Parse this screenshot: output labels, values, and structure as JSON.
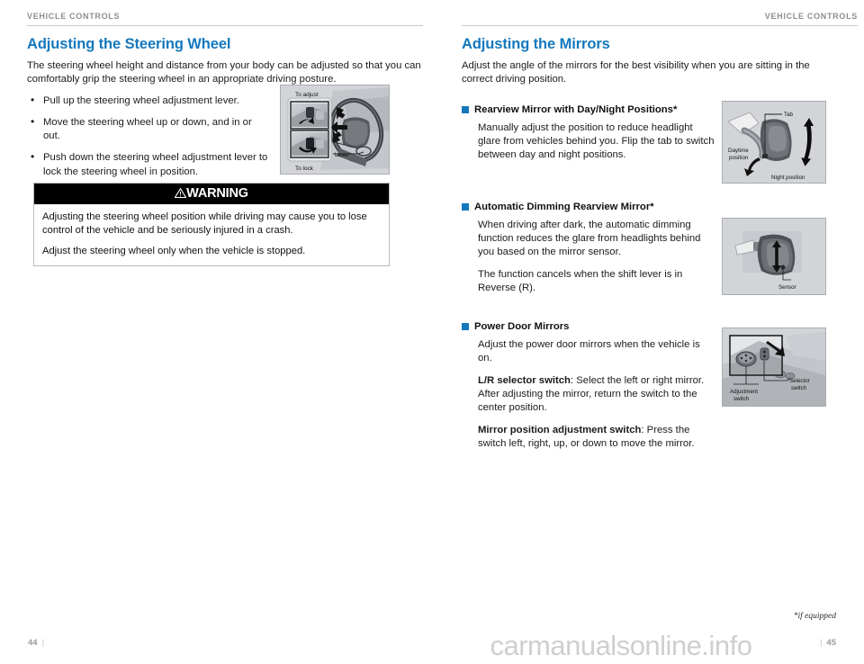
{
  "document": {
    "running_head_left": "VEHICLE CONTROLS",
    "running_head_right": "VEHICLE CONTROLS",
    "footnote": "*if equipped",
    "watermark": "carmanualsonline.info",
    "page_number_left": "44",
    "page_number_right": "45",
    "accent_color": "#1478bd",
    "rule_color": "#c9c9c9"
  },
  "left_column": {
    "title": "Adjusting the Steering Wheel",
    "intro": "The steering wheel height and distance from your body can be adjusted so that you can comfortably grip the steering wheel in an appropriate driving posture.",
    "bullets": [
      "Pull up the steering wheel adjustment lever.",
      "Move the steering wheel up or down, and in or out.",
      "Push down the steering wheel adjustment lever to lock the steering wheel in position."
    ],
    "warning": {
      "title": "WARNING",
      "icon": "warning-triangle-icon",
      "paragraphs": [
        "Adjusting the steering wheel position while driving may cause you to lose control of the vehicle and be seriously injured in a crash.",
        "Adjust the steering wheel only when the vehicle is stopped."
      ]
    },
    "figure": {
      "name": "steering-wheel-adjustment-illustration",
      "labels": {
        "to_adjust": "To adjust",
        "to_lock": "To lock",
        "lever": "Lever"
      }
    }
  },
  "right_column": {
    "title": "Adjusting the Mirrors",
    "intro": "Adjust the angle of the mirrors for the best visibility when you are sitting in the correct driving position.",
    "subsections": [
      {
        "heading": "Rearview Mirror with Day/Night Positions*",
        "paragraphs": [
          {
            "lead": "",
            "text": "Manually adjust the position to reduce headlight glare from vehicles behind you. Flip the tab to switch between day and night positions."
          }
        ],
        "figure": {
          "name": "rearview-mirror-day-night-illustration",
          "labels": {
            "tab": "Tab",
            "daytime_position": "Daytime position",
            "night_position": "Night position"
          }
        }
      },
      {
        "heading": "Automatic Dimming Rearview Mirror*",
        "paragraphs": [
          {
            "lead": "",
            "text": "When driving after dark, the automatic dimming function reduces the glare from headlights behind you based on the mirror sensor."
          },
          {
            "lead": "",
            "text": "The function cancels when the shift lever is in Reverse (R)."
          }
        ],
        "figure": {
          "name": "auto-dimming-mirror-illustration",
          "labels": {
            "sensor": "Sensor"
          }
        }
      },
      {
        "heading": "Power Door Mirrors",
        "paragraphs": [
          {
            "lead": "",
            "text": "Adjust the power door mirrors when the vehicle is on."
          },
          {
            "lead": "L/R selector switch",
            "text": ": Select the left or right mirror. After adjusting the mirror, return the switch to the center position."
          },
          {
            "lead": "Mirror position adjustment switch",
            "text": ": Press the switch left, right, up, or down to move the mirror."
          }
        ],
        "figure": {
          "name": "power-door-mirror-switch-illustration",
          "labels": {
            "adjustment_switch": "Adjustment switch",
            "selector_switch": "Selector switch"
          }
        }
      }
    ]
  }
}
